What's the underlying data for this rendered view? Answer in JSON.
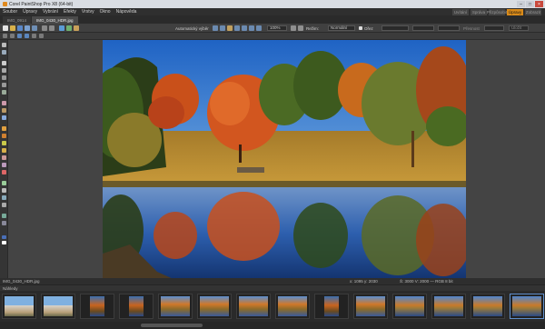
{
  "window": {
    "title": "Corel PaintShop Pro X8 (64-bit)"
  },
  "menu": [
    "Soubor",
    "Úpravy",
    "Vybrání",
    "Efekty",
    "Vrstvy",
    "Okno",
    "Nápověda"
  ],
  "modes": [
    "Uvítání",
    "Správa",
    "Přizpůsobit",
    "Úpravy",
    "Zobrazit"
  ],
  "active_mode": "Úpravy",
  "tabs": [
    "IMG_0914",
    "IMG_0430_HDR.jpg"
  ],
  "toolbar": {
    "auto_label": "Automatický výběr",
    "zoom_value": "100%",
    "mode_label": "Režim:",
    "mode_value": "Normální",
    "checkbox_label": "Ořez",
    "right_label1": "Přesnost",
    "right_label2": "Uložit"
  },
  "status": {
    "file": "IMG_0430_HDR.jpg",
    "position": "x: 1095 y: 2030",
    "size": "Š: 3000 V: 2000 — RGB 8 bit"
  },
  "filmstrip": {
    "label": "Náhledy",
    "thumbs": [
      {
        "selected": false,
        "kind": "house"
      },
      {
        "selected": false,
        "kind": "house"
      },
      {
        "selected": false,
        "kind": "portrait"
      },
      {
        "selected": false,
        "kind": "portrait"
      },
      {
        "selected": false,
        "kind": "autumn"
      },
      {
        "selected": false,
        "kind": "autumn"
      },
      {
        "selected": false,
        "kind": "autumn"
      },
      {
        "selected": false,
        "kind": "autumn"
      },
      {
        "selected": false,
        "kind": "portrait"
      },
      {
        "selected": false,
        "kind": "autumn"
      },
      {
        "selected": false,
        "kind": "wide"
      },
      {
        "selected": false,
        "kind": "wide"
      },
      {
        "selected": false,
        "kind": "wide"
      },
      {
        "selected": true,
        "kind": "wide"
      }
    ]
  }
}
